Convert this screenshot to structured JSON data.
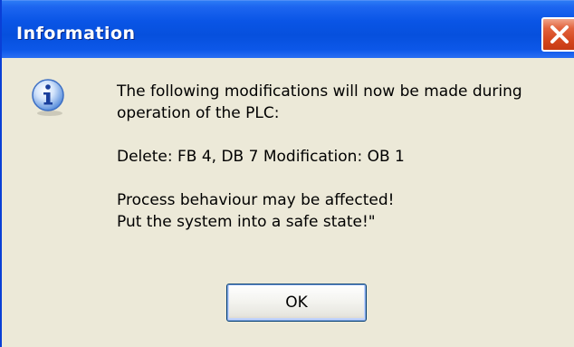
{
  "window": {
    "title": "Information"
  },
  "icons": {
    "info": "info-icon",
    "close": "close-icon"
  },
  "message": {
    "line1": "The following modifications will now be made during",
    "line2": "operation of the PLC:",
    "line3": "Delete: FB 4, DB 7   Modification: OB 1",
    "line4": "Process behaviour may be affected!",
    "line5": "Put the system into a safe state!\""
  },
  "buttons": {
    "ok_label": "OK"
  },
  "colors": {
    "titlebar": "#0a55e6",
    "close_button": "#d4461d",
    "dialog_background": "#ece9d8"
  }
}
